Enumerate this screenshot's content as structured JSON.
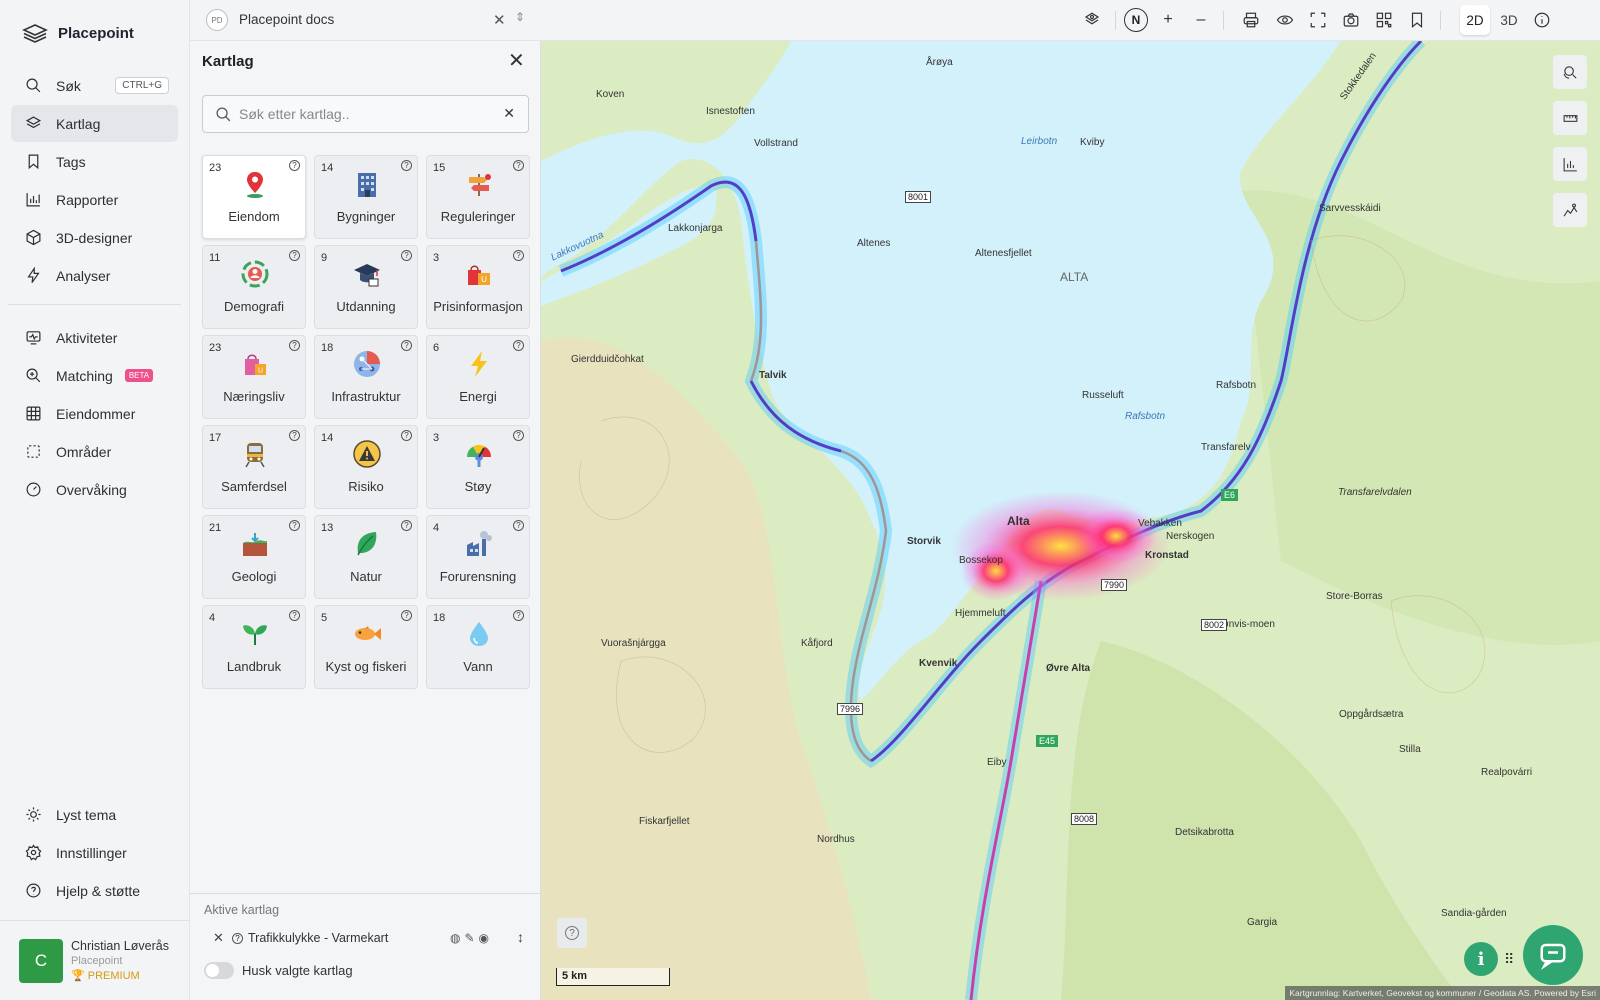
{
  "app": {
    "name": "Placepoint"
  },
  "nav": {
    "search": {
      "label": "Søk",
      "shortcut": "CTRL+G"
    },
    "items": [
      {
        "label": "Kartlag"
      },
      {
        "label": "Tags"
      },
      {
        "label": "Rapporter"
      },
      {
        "label": "3D-designer"
      },
      {
        "label": "Analyser"
      }
    ],
    "items2": [
      {
        "label": "Aktiviteter"
      },
      {
        "label": "Matching",
        "badge": "BETA"
      },
      {
        "label": "Eiendommer"
      },
      {
        "label": "Områder"
      },
      {
        "label": "Overvåking"
      }
    ],
    "bottom": [
      {
        "label": "Lyst tema"
      },
      {
        "label": "Innstillinger"
      },
      {
        "label": "Hjelp & støtte"
      }
    ],
    "user": {
      "initial": "C",
      "name": "Christian Løverås",
      "org": "Placepoint",
      "plan": "PREMIUM"
    }
  },
  "topbar": {
    "doc_badge": "PD",
    "doc_title": "Placepoint docs",
    "north": "N",
    "zoom_in": "+",
    "zoom_out": "–",
    "mode_2d": "2D",
    "mode_3d": "3D"
  },
  "panel": {
    "title": "Kartlag",
    "search_placeholder": "Søk etter kartlag..",
    "categories": [
      {
        "count": "23",
        "label": "Eiendom",
        "icon": "location-pin-icon"
      },
      {
        "count": "14",
        "label": "Bygninger",
        "icon": "building-icon"
      },
      {
        "count": "15",
        "label": "Reguleringer",
        "icon": "signpost-icon"
      },
      {
        "count": "11",
        "label": "Demografi",
        "icon": "people-circle-icon"
      },
      {
        "count": "9",
        "label": "Utdanning",
        "icon": "graduation-cap-icon"
      },
      {
        "count": "3",
        "label": "Prisinformasjon",
        "icon": "price-tag-icon"
      },
      {
        "count": "23",
        "label": "Næringsliv",
        "icon": "shopping-bag-icon"
      },
      {
        "count": "18",
        "label": "Infrastruktur",
        "icon": "network-icon"
      },
      {
        "count": "6",
        "label": "Energi",
        "icon": "lightning-icon"
      },
      {
        "count": "17",
        "label": "Samferdsel",
        "icon": "train-icon"
      },
      {
        "count": "14",
        "label": "Risiko",
        "icon": "warning-icon"
      },
      {
        "count": "3",
        "label": "Støy",
        "icon": "gauge-icon"
      },
      {
        "count": "21",
        "label": "Geologi",
        "icon": "soil-layers-icon"
      },
      {
        "count": "13",
        "label": "Natur",
        "icon": "leaf-icon"
      },
      {
        "count": "4",
        "label": "Forurensning",
        "icon": "factory-icon"
      },
      {
        "count": "4",
        "label": "Landbruk",
        "icon": "sprout-icon"
      },
      {
        "count": "5",
        "label": "Kyst og fiskeri",
        "icon": "fish-icon"
      },
      {
        "count": "18",
        "label": "Vann",
        "icon": "water-drop-icon"
      }
    ],
    "active_title": "Aktive kartlag",
    "active_layers": [
      {
        "name": "Trafikkulykke - Varmekart"
      }
    ],
    "remember_label": "Husk valgte kartlag"
  },
  "map": {
    "labels": [
      {
        "text": "Koven"
      },
      {
        "text": "Isnestoften"
      },
      {
        "text": "Vollstrand"
      },
      {
        "text": "Årøya"
      },
      {
        "text": "Leirbotn"
      },
      {
        "text": "Kviby"
      },
      {
        "text": "Altenes"
      },
      {
        "text": "Altenesfjellet"
      },
      {
        "text": "ALTA"
      },
      {
        "text": "Lakkonjarga"
      },
      {
        "text": "Talvik"
      },
      {
        "text": "Russeluft"
      },
      {
        "text": "Rafsbotn"
      },
      {
        "text": "Transfarelv"
      },
      {
        "text": "Alta"
      },
      {
        "text": "Bossekop"
      },
      {
        "text": "Kronstad"
      },
      {
        "text": "Storvik"
      },
      {
        "text": "Hjemmeluft"
      },
      {
        "text": "Kåfjord"
      },
      {
        "text": "Kvenvik"
      },
      {
        "text": "Øvre Alta"
      },
      {
        "text": "Store-Borras"
      },
      {
        "text": "Sarvvesskáidi"
      },
      {
        "text": "Transfarelvdalen"
      },
      {
        "text": "Nordhus"
      },
      {
        "text": "Eiby"
      },
      {
        "text": "Fiskarfjellet"
      },
      {
        "text": "Gargia"
      },
      {
        "text": "Stilla"
      },
      {
        "text": "Realpovárri"
      },
      {
        "text": "Oppgårdsætra"
      },
      {
        "text": "Detsikabrotta"
      },
      {
        "text": "Vuorašnjárgga"
      },
      {
        "text": "Gierdduidčohkat"
      },
      {
        "text": "Sandia-gården"
      },
      {
        "text": "Stokkedalen"
      },
      {
        "text": "Rafsbotn"
      },
      {
        "text": "Nerskogen"
      },
      {
        "text": "Vebakken"
      },
      {
        "text": "Sønvis-moen"
      },
      {
        "text": "Lakkovuotna"
      }
    ],
    "road_badges": [
      "8001",
      "7990",
      "8002",
      "7996",
      "8008",
      "E6",
      "E45"
    ],
    "scale": "5 km",
    "attribution": "Kartgrunnlag: Kartverket, Geovekst og kommuner / Geodata AS. Powered by Esri"
  }
}
